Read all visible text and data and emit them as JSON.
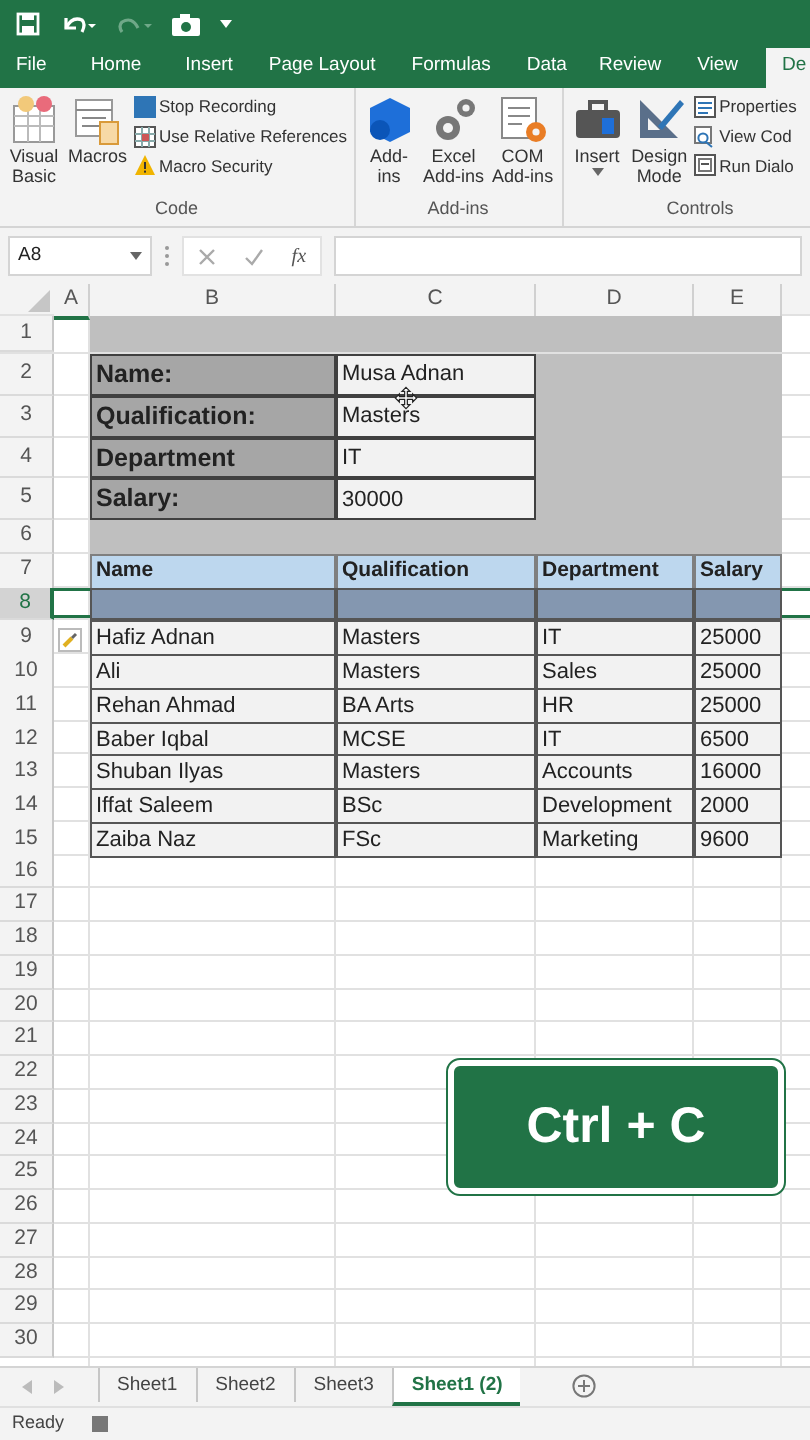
{
  "tabs": [
    {
      "label": "File",
      "selected": false
    },
    {
      "label": "Home",
      "selected": false
    },
    {
      "label": "Insert",
      "selected": false
    },
    {
      "label": "Page Layout",
      "selected": false
    },
    {
      "label": "Formulas",
      "selected": false
    },
    {
      "label": "Data",
      "selected": false
    },
    {
      "label": "Review",
      "selected": false
    },
    {
      "label": "View",
      "selected": false
    },
    {
      "label": "De",
      "selected": true
    }
  ],
  "ribbon": [
    {
      "label": "Code",
      "items": [
        {
          "kind": "large",
          "label": "Visual\nBasic"
        },
        {
          "kind": "large",
          "label": "Macros"
        },
        {
          "kind": "small",
          "label": "Stop Recording"
        },
        {
          "kind": "small",
          "label": "Use Relative References"
        },
        {
          "kind": "small",
          "label": "Macro Security"
        }
      ]
    },
    {
      "label": "Add-ins",
      "items": [
        {
          "kind": "large",
          "label": "Add-\nins"
        },
        {
          "kind": "large",
          "label": "Excel\nAdd-ins"
        },
        {
          "kind": "large",
          "label": "COM\nAdd-ins"
        }
      ]
    },
    {
      "label": "Controls",
      "items": [
        {
          "kind": "menu",
          "label": "Insert"
        },
        {
          "kind": "large",
          "label": "Design\nMode"
        },
        {
          "kind": "small",
          "label": "Properties"
        },
        {
          "kind": "small",
          "label": "View Cod"
        },
        {
          "kind": "small",
          "label": "Run Dialo"
        }
      ]
    }
  ],
  "formula_bar": {
    "name_box": "A8",
    "fx": "fx"
  },
  "columns": [
    "A",
    "B",
    "C",
    "D",
    "E"
  ],
  "rows": [
    {
      "number": "1",
      "kind": "band",
      "selected": false,
      "cells": []
    },
    {
      "number": "2",
      "kind": "form",
      "selected": false,
      "cells": [
        "Name:",
        "Musa Adnan"
      ]
    },
    {
      "number": "3",
      "kind": "form",
      "selected": false,
      "cells": [
        "Qualification:",
        "Masters"
      ]
    },
    {
      "number": "4",
      "kind": "form",
      "selected": false,
      "cells": [
        "Department",
        "IT"
      ]
    },
    {
      "number": "5",
      "kind": "form",
      "selected": false,
      "cells": [
        "Salary:",
        "30000"
      ]
    },
    {
      "number": "6",
      "kind": "band",
      "selected": false,
      "cells": []
    },
    {
      "number": "7",
      "kind": "header",
      "selected": false,
      "cells": [
        "Name",
        "Qualification",
        "Department",
        "Salary"
      ]
    },
    {
      "number": "8",
      "kind": "blank",
      "selected": true,
      "cells": []
    },
    {
      "number": "9",
      "kind": "data",
      "selected": false,
      "cells": [
        "Hafiz Adnan",
        "Masters",
        "IT",
        "25000"
      ]
    },
    {
      "number": "10",
      "kind": "data",
      "selected": false,
      "cells": [
        "Ali",
        "Masters",
        "Sales",
        "25000"
      ]
    },
    {
      "number": "11",
      "kind": "data",
      "selected": false,
      "cells": [
        "Rehan Ahmad",
        "BA Arts",
        "HR",
        "25000"
      ]
    },
    {
      "number": "12",
      "kind": "data",
      "selected": false,
      "cells": [
        "Baber Iqbal",
        "MCSE",
        "IT",
        "6500"
      ]
    },
    {
      "number": "13",
      "kind": "data",
      "selected": false,
      "cells": [
        "Shuban Ilyas",
        "Masters",
        "Accounts",
        "16000"
      ]
    },
    {
      "number": "14",
      "kind": "data",
      "selected": false,
      "cells": [
        "Iffat Saleem",
        "BSc",
        "Development",
        "2000"
      ]
    },
    {
      "number": "15",
      "kind": "data",
      "selected": false,
      "cells": [
        "Zaiba Naz",
        "FSc",
        "Marketing",
        "9600"
      ]
    },
    {
      "number": "16",
      "kind": "empty",
      "selected": false,
      "cells": []
    },
    {
      "number": "17",
      "kind": "empty",
      "selected": false,
      "cells": []
    },
    {
      "number": "18",
      "kind": "empty",
      "selected": false,
      "cells": []
    },
    {
      "number": "19",
      "kind": "empty",
      "selected": false,
      "cells": []
    },
    {
      "number": "20",
      "kind": "empty",
      "selected": false,
      "cells": []
    },
    {
      "number": "21",
      "kind": "empty",
      "selected": false,
      "cells": []
    },
    {
      "number": "22",
      "kind": "empty",
      "selected": false,
      "cells": []
    },
    {
      "number": "23",
      "kind": "empty",
      "selected": false,
      "cells": []
    },
    {
      "number": "24",
      "kind": "empty",
      "selected": false,
      "cells": []
    },
    {
      "number": "25",
      "kind": "empty",
      "selected": false,
      "cells": []
    },
    {
      "number": "26",
      "kind": "empty",
      "selected": false,
      "cells": []
    },
    {
      "number": "27",
      "kind": "empty",
      "selected": false,
      "cells": []
    },
    {
      "number": "28",
      "kind": "empty",
      "selected": false,
      "cells": []
    },
    {
      "number": "29",
      "kind": "empty",
      "selected": false,
      "cells": []
    },
    {
      "number": "30",
      "kind": "empty",
      "selected": false,
      "cells": []
    }
  ],
  "caption": "Ctrl + C",
  "sheets": [
    {
      "label": "Sheet1",
      "selected": false
    },
    {
      "label": "Sheet2",
      "selected": false
    },
    {
      "label": "Sheet3",
      "selected": false
    },
    {
      "label": "Sheet1 (2)",
      "selected": true
    }
  ],
  "status_bar": {
    "text": "Ready"
  }
}
